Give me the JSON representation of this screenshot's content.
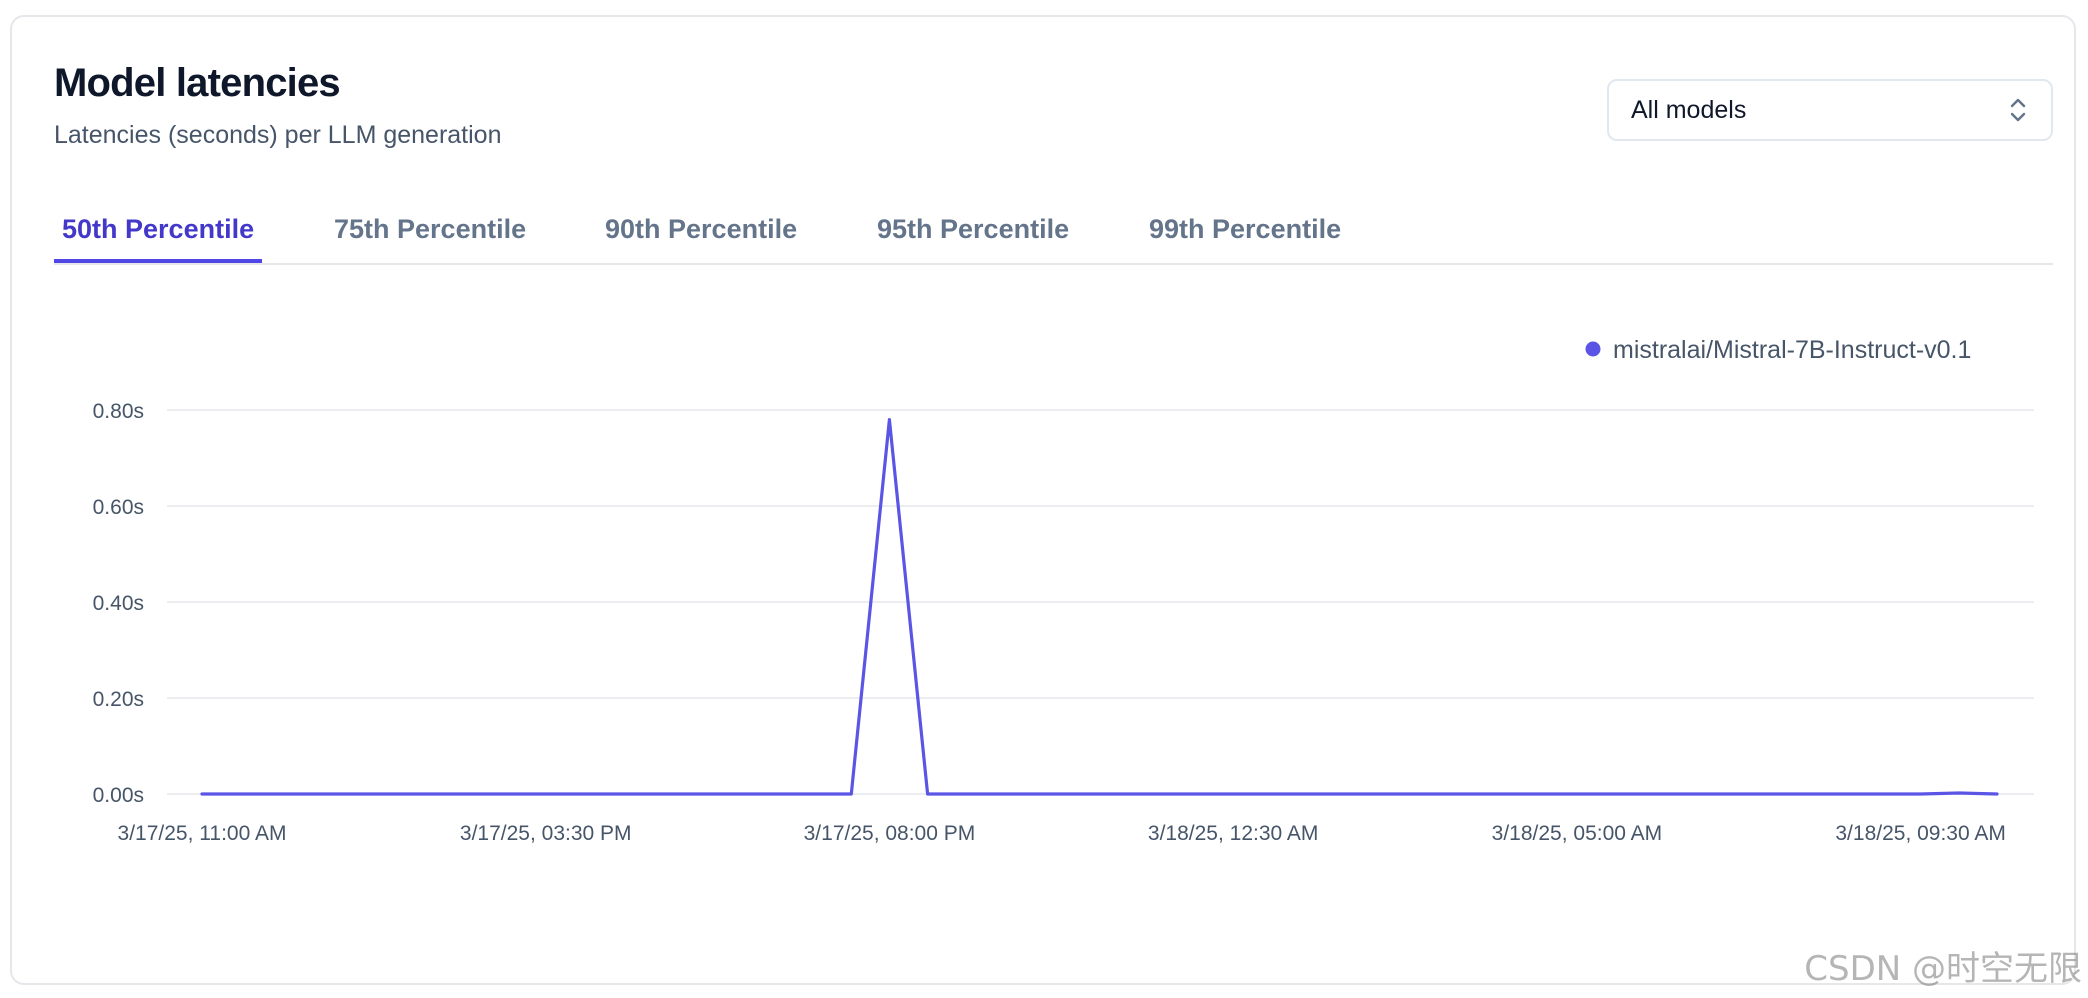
{
  "card": {
    "title": "Model latencies",
    "subtitle": "Latencies (seconds) per LLM generation"
  },
  "model_select": {
    "value": "All models",
    "icon": "chevron-up-down-icon"
  },
  "tabs": [
    {
      "label": "50th Percentile",
      "active": true
    },
    {
      "label": "75th Percentile",
      "active": false
    },
    {
      "label": "90th Percentile",
      "active": false
    },
    {
      "label": "95th Percentile",
      "active": false
    },
    {
      "label": "99th Percentile",
      "active": false
    }
  ],
  "colors": {
    "accent": "#4f46e5",
    "line": "#5b55e6",
    "grid": "#e5e7eb",
    "text_muted": "#475569"
  },
  "chart_data": {
    "type": "line",
    "legend_position": "top-right",
    "grid": true,
    "y_tick_labels": [
      "0.00s",
      "0.20s",
      "0.40s",
      "0.60s",
      "0.80s"
    ],
    "y_ticks": [
      0,
      0.2,
      0.4,
      0.6,
      0.8
    ],
    "ylim": [
      0,
      0.8
    ],
    "x_tick_labels": [
      "3/17/25, 11:00 AM",
      "3/17/25, 03:30 PM",
      "3/17/25, 08:00 PM",
      "3/18/25, 12:30 AM",
      "3/18/25, 05:00 AM",
      "3/18/25, 09:30 AM"
    ],
    "x_ticks": [
      "2025-03-17T11:00",
      "2025-03-17T15:30",
      "2025-03-17T20:00",
      "2025-03-18T00:30",
      "2025-03-18T05:00",
      "2025-03-18T09:30"
    ],
    "xlim": [
      "2025-03-17T11:00",
      "2025-03-18T10:30"
    ],
    "series": [
      {
        "name": "mistralai/Mistral-7B-Instruct-v0.1",
        "x": [
          "2025-03-17T11:00",
          "2025-03-17T19:30",
          "2025-03-17T20:00",
          "2025-03-17T20:30",
          "2025-03-18T09:30",
          "2025-03-18T10:00",
          "2025-03-18T10:30"
        ],
        "y": [
          0,
          0,
          0.78,
          0,
          0,
          0.002,
          0
        ]
      }
    ]
  },
  "watermark": "CSDN @时空无限"
}
